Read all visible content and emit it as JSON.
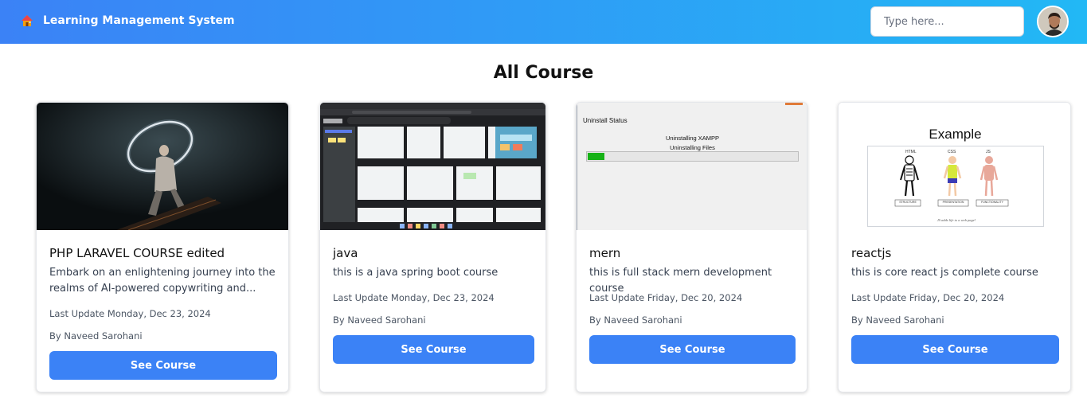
{
  "header": {
    "brand_icon": "house-icon",
    "title": "Learning Management System",
    "search_placeholder": "Type here...",
    "avatar": "user-avatar"
  },
  "main": {
    "title": "All Course",
    "courses": [
      {
        "title": "PHP LARAVEL COURSE edited",
        "description": "Embark on an enlightening journey into the realms of AI-powered copywriting and...",
        "last_update": "Last Update Monday, Dec 23, 2024",
        "author": "By Naveed Sarohani",
        "button": "See Course"
      },
      {
        "title": "java",
        "description": "this is a java spring boot course",
        "last_update": "Last Update Monday, Dec 23, 2024",
        "author": "By Naveed Sarohani",
        "button": "See Course"
      },
      {
        "title": "mern",
        "description": "this is full stack mern development course",
        "last_update": "Last Update Friday, Dec 20, 2024",
        "author": "By Naveed Sarohani",
        "button": "See Course",
        "thumb_text": {
          "window_title": "Uninstall Status",
          "line1": "Uninstalling XAMPP",
          "line2": "Uninstalling Files"
        },
        "thumb_progress": 0.08
      },
      {
        "title": "reactjs",
        "description": "this is core react js complete course",
        "last_update": "Last Update Friday, Dec 20, 2024",
        "author": "By Naveed Sarohani",
        "button": "See Course",
        "thumb_text": {
          "heading": "Example",
          "col1": "HTML",
          "col2": "CSS",
          "col3": "JS",
          "label1": "STRUCTURE",
          "label2": "PRESENTATION",
          "label3": "FUNCTIONALITY",
          "caption": "JS adds life to a web page!"
        }
      }
    ]
  },
  "colors": {
    "header_start": "#3b82f6",
    "header_end": "#22b8f5",
    "button": "#3b82f6",
    "progress": "#16b216"
  }
}
